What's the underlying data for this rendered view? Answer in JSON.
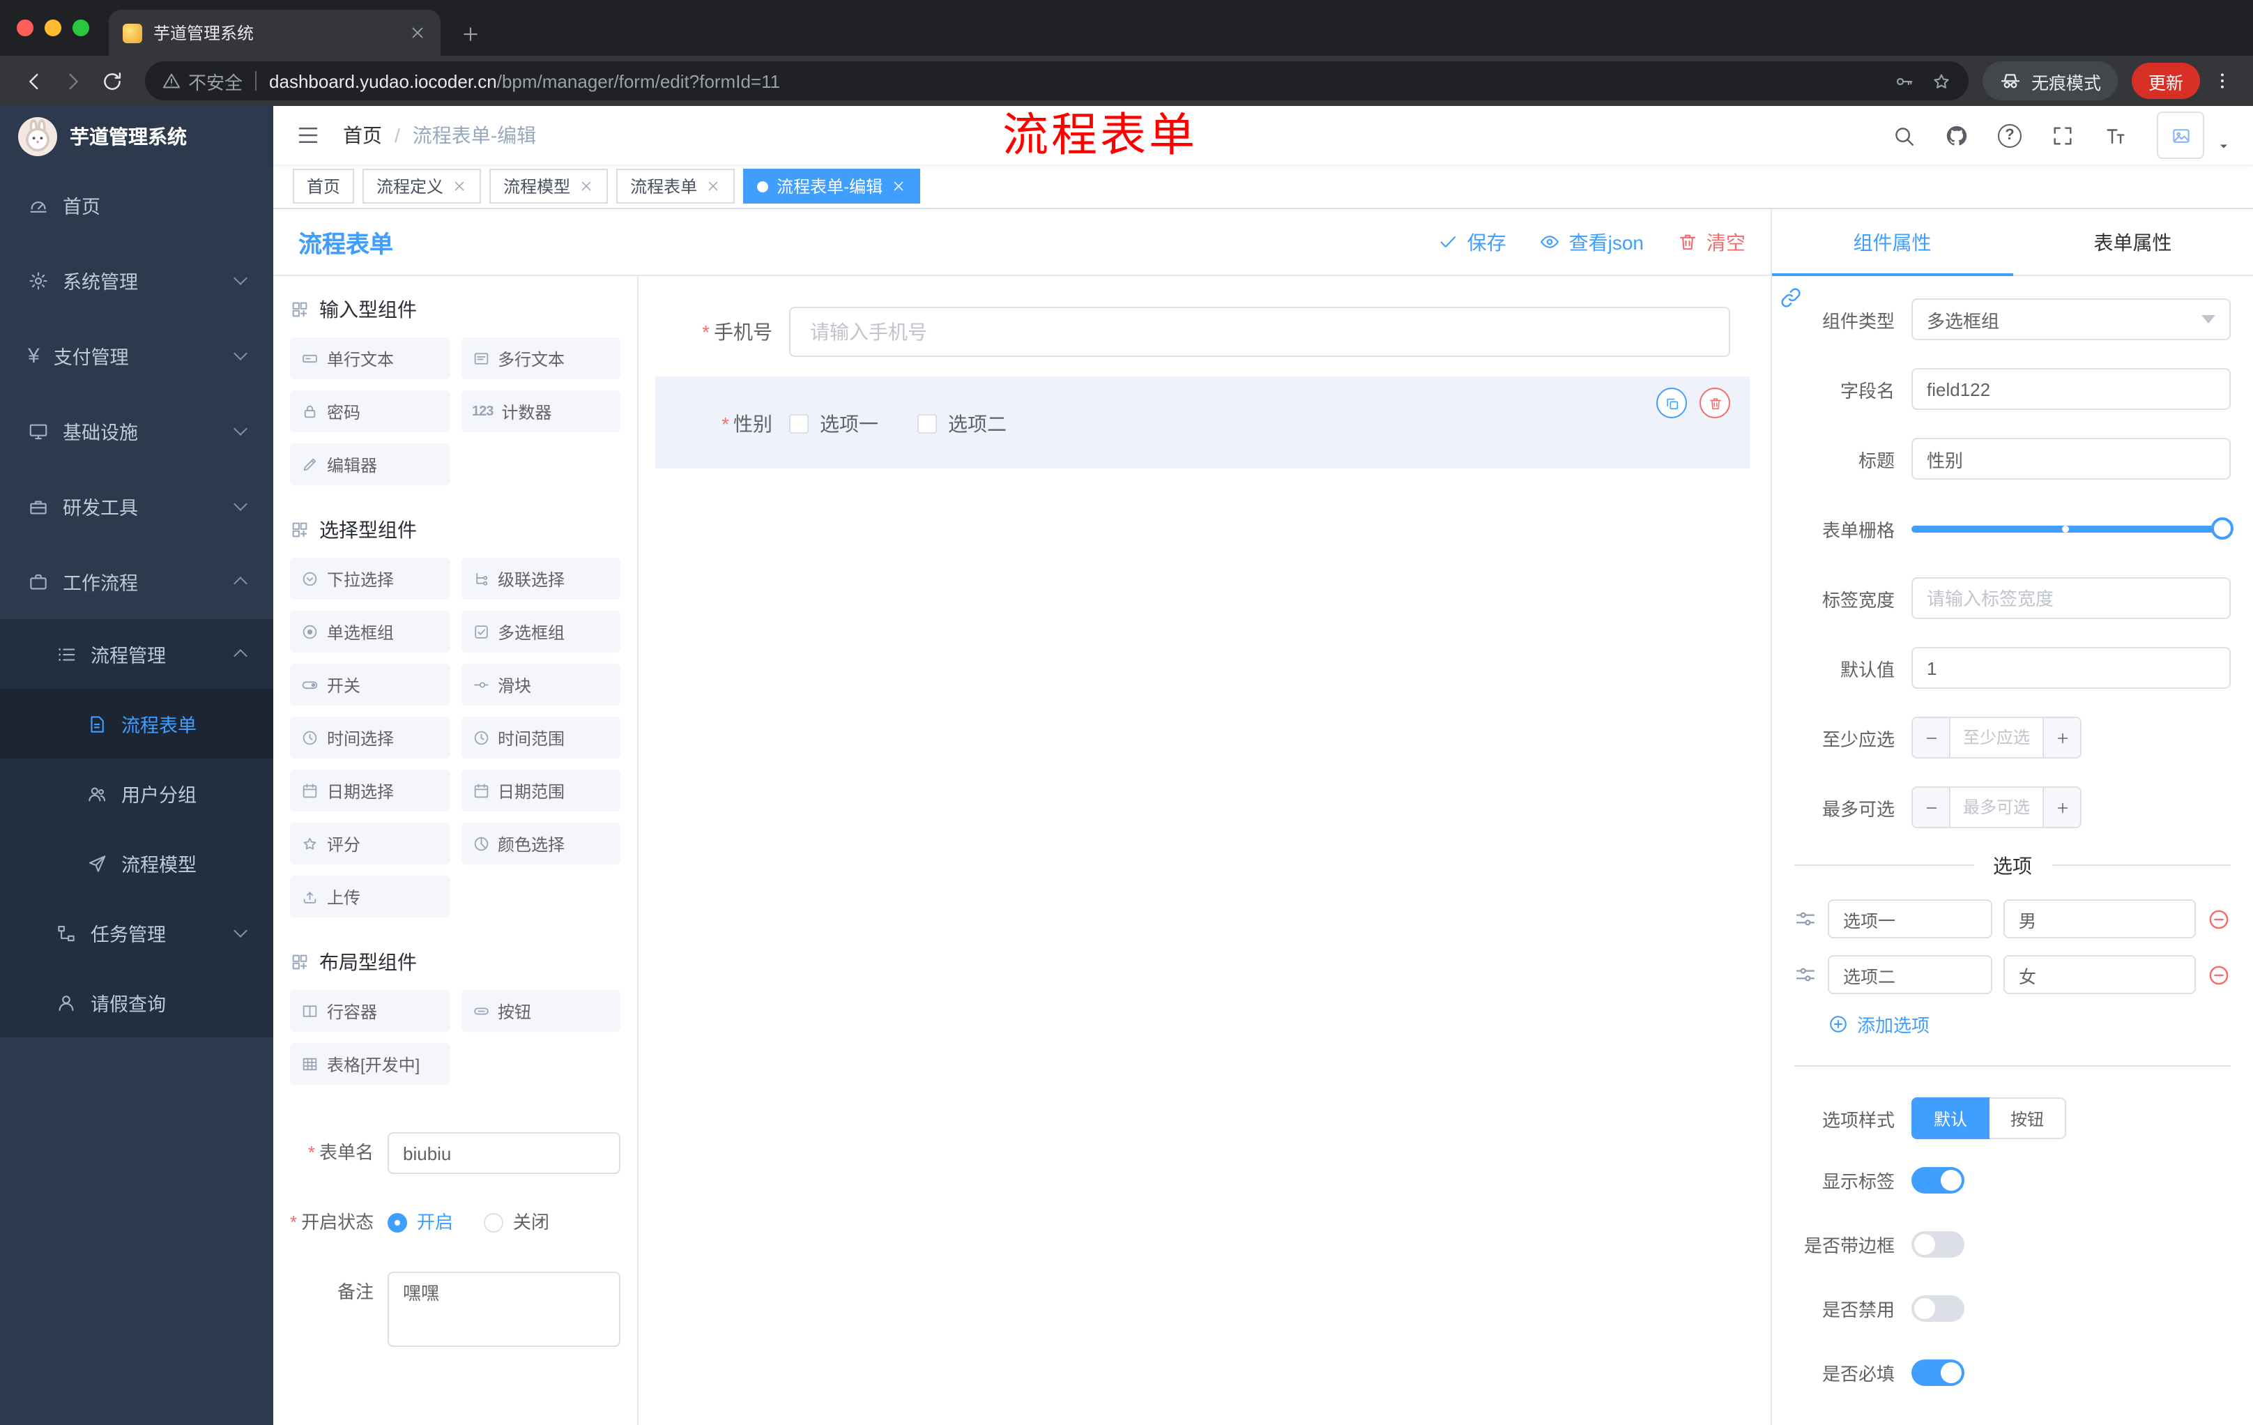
{
  "colors": {
    "primary": "#409EFF",
    "danger": "#F56C6C",
    "annotation": "#FF0000",
    "sidebar_bg": "#2D3A4E",
    "chrome_bg": "#202124",
    "active_tag_bg": "#409EFF"
  },
  "icons": {
    "note": "icon semantic names are carried on data-name attributes",
    "counter_icon_text": "123",
    "payment_icon_text": "¥"
  },
  "browser": {
    "tab_title": "芋道管理系统",
    "security_label": "不安全",
    "url_domain": "dashboard.yudao.iocoder.cn",
    "url_path": "/bpm/manager/form/edit?formId=11",
    "incognito_label": "无痕模式",
    "update_label": "更新"
  },
  "sidebar": {
    "logo_title": "芋道管理系统",
    "items": {
      "home": "首页",
      "system": "系统管理",
      "payment": "支付管理",
      "infra": "基础设施",
      "devtools": "研发工具",
      "workflow": "工作流程",
      "process_mgmt": "流程管理",
      "process_form": "流程表单",
      "user_group": "用户分组",
      "process_model": "流程模型",
      "task_mgmt": "任务管理",
      "leave_query": "请假查询"
    }
  },
  "header": {
    "breadcrumb_home": "首页",
    "breadcrumb_sep": "/",
    "breadcrumb_current": "流程表单-编辑",
    "annotation": "流程表单"
  },
  "tags": [
    {
      "label": "首页",
      "active": false
    },
    {
      "label": "流程定义",
      "active": false
    },
    {
      "label": "流程模型",
      "active": false
    },
    {
      "label": "流程表单",
      "active": false
    },
    {
      "label": "流程表单-编辑",
      "active": true
    }
  ],
  "designer": {
    "title": "流程表单",
    "actions": {
      "save": "保存",
      "view_json": "查看json",
      "clear": "清空"
    },
    "sections": [
      {
        "title": "输入型组件",
        "items": [
          {
            "label": "单行文本"
          },
          {
            "label": "多行文本"
          },
          {
            "label": "密码"
          },
          {
            "label": "计数器",
            "icon_text": "123"
          },
          {
            "label": "编辑器"
          }
        ]
      },
      {
        "title": "选择型组件",
        "items": [
          {
            "label": "下拉选择"
          },
          {
            "label": "级联选择"
          },
          {
            "label": "单选框组"
          },
          {
            "label": "多选框组"
          },
          {
            "label": "开关"
          },
          {
            "label": "滑块"
          },
          {
            "label": "时间选择"
          },
          {
            "label": "时间范围"
          },
          {
            "label": "日期选择"
          },
          {
            "label": "日期范围"
          },
          {
            "label": "评分"
          },
          {
            "label": "颜色选择"
          },
          {
            "label": "上传"
          }
        ]
      },
      {
        "title": "布局型组件",
        "items": [
          {
            "label": "行容器"
          },
          {
            "label": "按钮"
          },
          {
            "label": "表格[开发中]"
          }
        ]
      }
    ],
    "meta": {
      "form_name_label": "表单名",
      "form_name_value": "biubiu",
      "status_label": "开启状态",
      "status_on": "开启",
      "status_on_checked": true,
      "status_off": "关闭",
      "remark_label": "备注",
      "remark_value": "嘿嘿"
    },
    "canvas": {
      "phone_label": "手机号",
      "phone_placeholder": "请输入手机号",
      "gender_label": "性别",
      "gender_options": [
        "选项一",
        "选项二"
      ]
    }
  },
  "panel": {
    "tab_component": "组件属性",
    "tab_form": "表单属性",
    "fields": {
      "type_label": "组件类型",
      "type_value": "多选框组",
      "field_label": "字段名",
      "field_value": "field122",
      "title_label": "标题",
      "title_value": "性别",
      "grid_label": "表单栅格",
      "label_width_label": "标签宽度",
      "label_width_placeholder": "请输入标签宽度",
      "default_label": "默认值",
      "default_value": "1",
      "min_label": "至少应选",
      "min_placeholder": "至少应选",
      "max_label": "最多可选",
      "max_placeholder": "最多可选"
    },
    "options_divider": "选项",
    "options": [
      {
        "label": "选项一",
        "value": "男"
      },
      {
        "label": "选项二",
        "value": "女"
      }
    ],
    "add_option": "添加选项",
    "style_label": "选项样式",
    "style_default": "默认",
    "style_button": "按钮",
    "switches": [
      {
        "label": "显示标签",
        "on": true
      },
      {
        "label": "是否带边框",
        "on": false
      },
      {
        "label": "是否禁用",
        "on": false
      },
      {
        "label": "是否必填",
        "on": true
      }
    ]
  }
}
